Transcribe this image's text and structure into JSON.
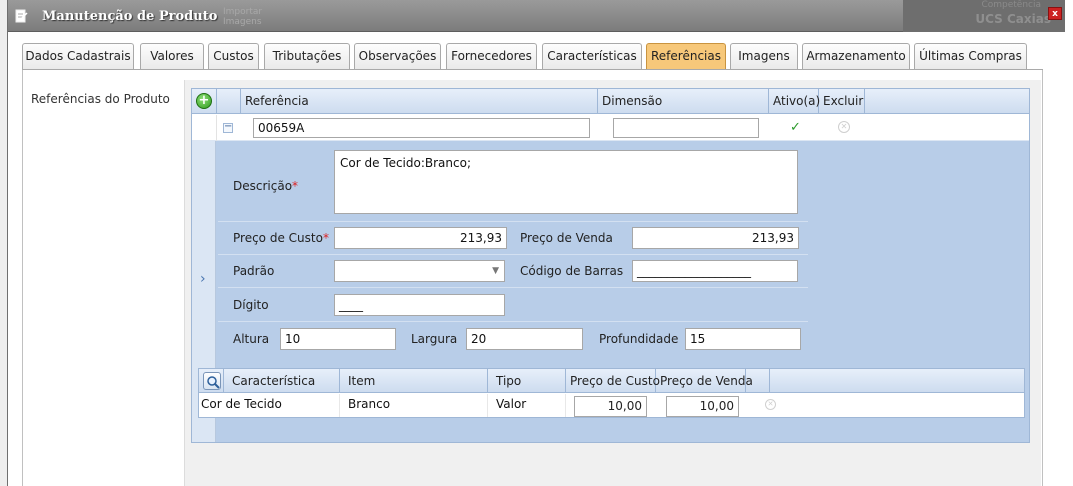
{
  "window": {
    "title": "Manutenção de Produto",
    "ghost_text_line1": "Importar",
    "ghost_text_line2": "Imagens",
    "bg_right_top": "Competência",
    "bg_right_text": "UCS Caxias",
    "close_label": "x"
  },
  "tabs": [
    {
      "label": "Dados Cadastrais",
      "active": false
    },
    {
      "label": "Valores",
      "active": false
    },
    {
      "label": "Custos",
      "active": false
    },
    {
      "label": "Tributações",
      "active": false
    },
    {
      "label": "Observações",
      "active": false
    },
    {
      "label": "Fornecedores",
      "active": false
    },
    {
      "label": "Características",
      "active": false
    },
    {
      "label": "Referências",
      "active": true
    },
    {
      "label": "Imagens",
      "active": false
    },
    {
      "label": "Armazenamento",
      "active": false
    },
    {
      "label": "Últimas Compras",
      "active": false
    }
  ],
  "section_label": "Referências do Produto",
  "grid": {
    "add_label": "+",
    "headers": {
      "referencia": "Referência",
      "dimensao": "Dimensão",
      "ativo": "Ativo(a)",
      "excluir": "Excluir"
    },
    "row": {
      "collapse": "−",
      "referencia": "00659A",
      "dimensao": "",
      "ativo_mark": "✓",
      "ativo_checked": true,
      "excluir_mark": "✕"
    }
  },
  "detail": {
    "expand_icon": "›",
    "descricao_label": "Descrição",
    "descricao_value": "Cor de Tecido:Branco;",
    "preco_custo_label": "Preço de Custo",
    "preco_custo_value": "213,93",
    "preco_venda_label": "Preço de Venda",
    "preco_venda_value": "213,93",
    "padrao_label": "Padrão",
    "padrao_value": "",
    "padrao_arrow": "▼",
    "codigo_barras_label": "Código de Barras",
    "codigo_barras_value": "___________________",
    "digito_label": "Dígito",
    "digito_value": "____",
    "altura_label": "Altura",
    "altura_value": "10",
    "largura_label": "Largura",
    "largura_value": "20",
    "profundidade_label": "Profundidade",
    "profundidade_value": "15",
    "required_mark": "*"
  },
  "characteristics": {
    "headers": {
      "caracteristica": "Característica",
      "item": "Item",
      "tipo": "Tipo",
      "preco_custo": "Preço de Custo",
      "preco_venda": "Preço de Venda"
    },
    "rows": [
      {
        "caracteristica": "Cor de Tecido",
        "item": "Branco",
        "tipo": "Valor",
        "preco_custo": "10,00",
        "preco_venda": "10,00",
        "delete_mark": "✕"
      }
    ]
  }
}
